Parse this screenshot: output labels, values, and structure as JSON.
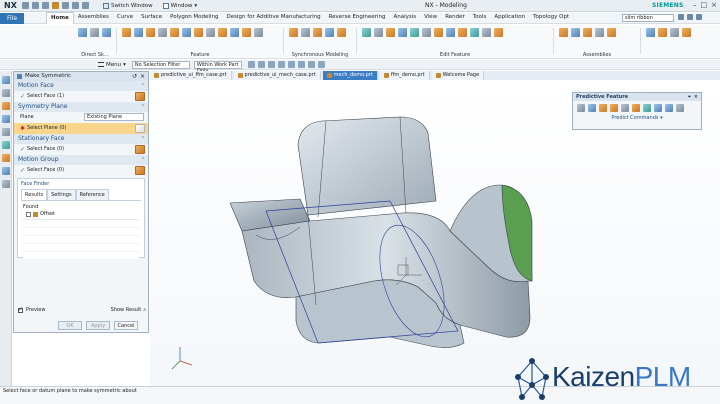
{
  "title_bar": {
    "logo": "NX",
    "switch_window": "Switch Window",
    "window_menu": "Window",
    "app_title": "NX - Modeling",
    "brand": "SIEMENS",
    "controls": [
      "–",
      "□",
      "×"
    ]
  },
  "menu_bar": {
    "file": "File",
    "tabs": [
      "Home",
      "Assemblies",
      "Curve",
      "Surface",
      "Polygon Modeling",
      "Design for Additive Manufacturing",
      "Reverse Engineering",
      "Analysis",
      "View",
      "Render",
      "Tools",
      "Application",
      "Topology Opt"
    ],
    "active_tab": "Home",
    "search_value": "slim ribbon"
  },
  "ribbon": {
    "groups": [
      "Direct Sk...",
      "Feature",
      "Synchronous Modeling",
      "Edit Feature",
      "Assemblies"
    ]
  },
  "selection_bar": {
    "menu_label": "Menu",
    "filter_value": "No Selection Filter",
    "scope_value": "Within Work Part Only"
  },
  "doc_tabs": [
    {
      "label": "predictive_ui_ffm_case.prt",
      "active": false
    },
    {
      "label": "predictive_ui_mech_case.prt",
      "active": false
    },
    {
      "label": "mech_demo.prt",
      "active": true
    },
    {
      "label": "ffm_demo.prt",
      "active": false
    },
    {
      "label": "Welcome Page",
      "active": false
    }
  ],
  "dialog": {
    "title": "Make Symmetric",
    "motion_face": {
      "section": "Motion Face",
      "row": "Select Face (1)"
    },
    "symmetry_plane": {
      "section": "Symmetry Plane",
      "plane_label": "Plane",
      "plane_value": "Existing Plane",
      "row": "Select Plane (0)"
    },
    "stationary_face": {
      "section": "Stationary Face",
      "row": "Select Face (0)"
    },
    "motion_group": {
      "section": "Motion Group",
      "row": "Select Face (0)"
    },
    "face_finder": {
      "title": "Face Finder",
      "tabs": [
        "Results",
        "Settings",
        "Reference"
      ],
      "found_label": "Found",
      "found_items": [
        "Offset"
      ]
    },
    "preview": "Preview",
    "show_result": "Show Result",
    "buttons": {
      "ok": "OK",
      "apply": "Apply",
      "cancel": "Cancel"
    }
  },
  "predictive_feature": {
    "title": "Predictive Feature",
    "commands_label": "Predict Commands"
  },
  "status_bar": {
    "message": "Select face or datum plane to make symmetric about"
  },
  "watermark": {
    "part1": "Kaizen",
    "part2": "PLM"
  },
  "colors": {
    "accent": "#2f75b5",
    "active_doc_tab": "#3a7dc4",
    "highlight_row": "#f7d58a",
    "brand": "#009999",
    "model_face": "#b9c5ce",
    "selected_face": "#5a9e4f"
  }
}
